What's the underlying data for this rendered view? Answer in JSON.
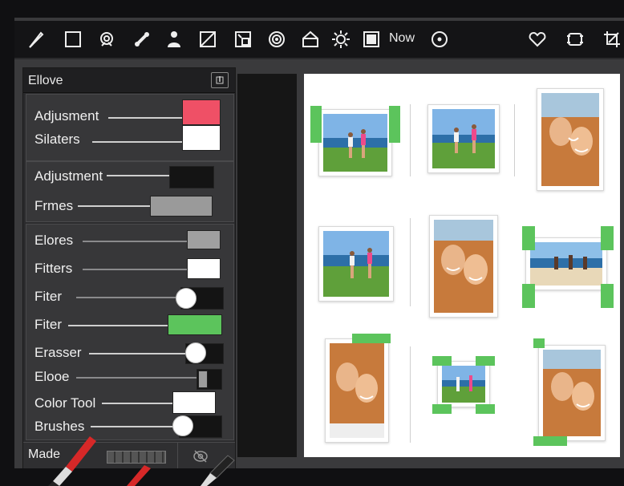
{
  "toolbar": {
    "tools": [
      "knife-icon",
      "rectangle-icon",
      "lasso-icon",
      "bone-icon",
      "person-icon",
      "crop-slash-icon",
      "transform-icon",
      "spiral-icon",
      "house-icon",
      "sun-icon",
      "frame-icon"
    ],
    "now_label": "Now",
    "right_tools": [
      "target-icon",
      "heart-icon",
      "resize-frame-icon",
      "crop-corner-icon"
    ]
  },
  "panel": {
    "title": "Ellove",
    "group1": {
      "adjusment_label": "Adjusment",
      "adjusment_color": "#ef5066",
      "silaters_label": "Silaters",
      "silaters_color": "#ffffff"
    },
    "group2": {
      "adjustment_label": "Adjustment",
      "adjustment_color": "#141414",
      "frmes_label": "Frmes",
      "frmes_color": "#9a9a9a"
    },
    "group3": {
      "elores_label": "Elores",
      "elores_color": "#a0a0a0",
      "fitters_label": "Fitters",
      "fitters_color": "#ffffff",
      "fiter1_label": "Fiter",
      "fiter2_label": "Fiter",
      "fiter2_color": "#5cc45c",
      "eraser_label": "Erasser",
      "elooe_label": "Elooe",
      "color_tool_label": "Color Tool",
      "color_tool_color": "#ffffff",
      "brushes_label": "Brushes"
    },
    "footer": {
      "made_label": "Made"
    }
  },
  "colors": {
    "accent_green": "#5cc45c",
    "panel_bg": "#2b2b2d",
    "canvas_bg": "#ffffff"
  }
}
